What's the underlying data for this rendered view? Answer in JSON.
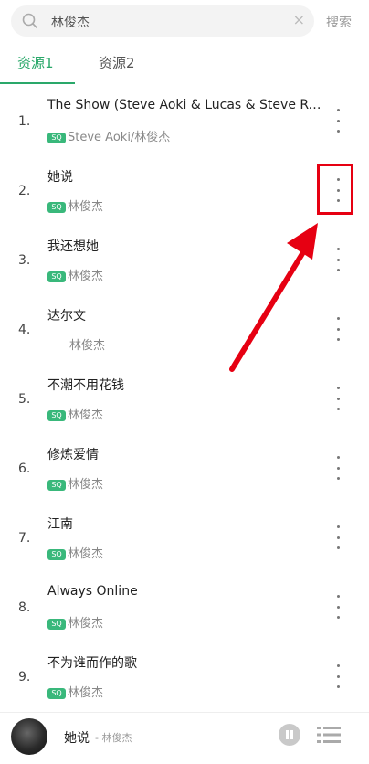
{
  "search": {
    "query": "林俊杰",
    "clear_glyph": "×",
    "button_label": "搜索"
  },
  "tabs": [
    {
      "label": "资源1",
      "active": true
    },
    {
      "label": "资源2",
      "active": false
    }
  ],
  "songs": [
    {
      "num": "1.",
      "title": "The Show (Steve Aoki & Lucas & Steve Re...",
      "sq": true,
      "artist": "Steve Aoki/林俊杰"
    },
    {
      "num": "2.",
      "title": "她说",
      "sq": true,
      "artist": "林俊杰"
    },
    {
      "num": "3.",
      "title": "我还想她",
      "sq": true,
      "artist": "林俊杰"
    },
    {
      "num": "4.",
      "title": "达尔文",
      "sq": false,
      "artist": "林俊杰"
    },
    {
      "num": "5.",
      "title": "不潮不用花钱",
      "sq": true,
      "artist": "林俊杰"
    },
    {
      "num": "6.",
      "title": "修炼爱情",
      "sq": true,
      "artist": "林俊杰"
    },
    {
      "num": "7.",
      "title": "江南",
      "sq": true,
      "artist": "林俊杰"
    },
    {
      "num": "8.",
      "title": "Always Online",
      "sq": true,
      "artist": "林俊杰"
    },
    {
      "num": "9.",
      "title": "不为谁而作的歌",
      "sq": true,
      "artist": "林俊杰"
    }
  ],
  "badge": {
    "label": "SQ"
  },
  "player": {
    "title": "她说",
    "artist": "- 林俊杰"
  },
  "colors": {
    "accent": "#2aa86a",
    "badge": "#39b87b",
    "highlight": "#e60012"
  }
}
